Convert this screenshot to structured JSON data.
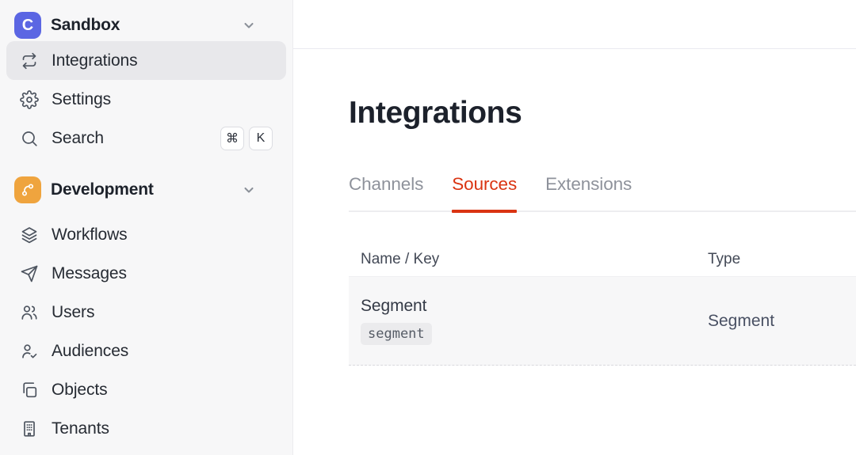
{
  "colors": {
    "accent": "#da3412",
    "logo-bg": "#5b66e3",
    "dev-bg": "#efa43e",
    "sidebar-bg": "#f7f7f8",
    "active-item-bg": "#e8e8eb",
    "row-bg": "#f7f7f8",
    "badge-bg": "#ebebed"
  },
  "sidebar": {
    "workspace": {
      "label": "Sandbox",
      "logo_letter": "C",
      "chevron_icon": "chevron-down-icon"
    },
    "nav": [
      {
        "label": "Integrations",
        "icon": "swap-arrows-icon",
        "active": true
      },
      {
        "label": "Settings",
        "icon": "gear-icon",
        "active": false
      },
      {
        "label": "Search",
        "icon": "search-icon",
        "active": false
      }
    ],
    "search_shortcut": {
      "keys": [
        "⌘",
        "K"
      ]
    },
    "section": {
      "label": "Development",
      "icon": "branch-icon",
      "chevron_icon": "chevron-down-icon"
    },
    "dev_nav": [
      {
        "label": "Workflows",
        "icon": "layers-icon"
      },
      {
        "label": "Messages",
        "icon": "paper-plane-icon"
      },
      {
        "label": "Users",
        "icon": "users-icon"
      },
      {
        "label": "Audiences",
        "icon": "person-check-icon"
      },
      {
        "label": "Objects",
        "icon": "copy-icon"
      },
      {
        "label": "Tenants",
        "icon": "building-icon"
      }
    ]
  },
  "main": {
    "title": "Integrations",
    "tabs": [
      {
        "label": "Channels",
        "active": false
      },
      {
        "label": "Sources",
        "active": true
      },
      {
        "label": "Extensions",
        "active": false
      }
    ],
    "table": {
      "columns": [
        {
          "label": "Name / Key"
        },
        {
          "label": "Type"
        }
      ],
      "rows": [
        {
          "name": "Segment",
          "key": "segment",
          "type": "Segment"
        }
      ]
    }
  }
}
